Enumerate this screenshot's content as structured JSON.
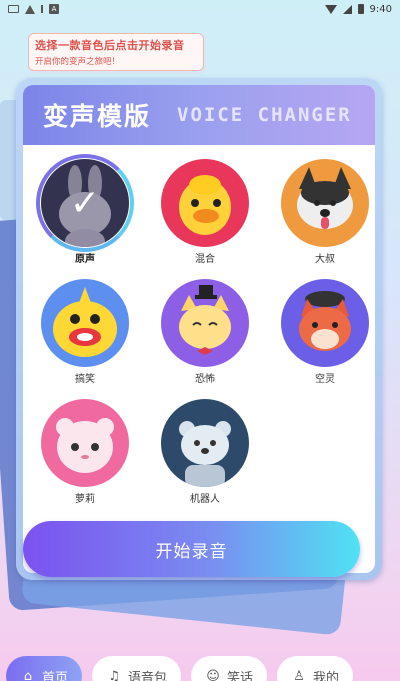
{
  "status_bar": {
    "time": "9:40"
  },
  "hint": {
    "main": "选择一款音色后点击开始录音",
    "sub": "开启你的变声之旅吧！"
  },
  "header": {
    "title_cn": "变声模版",
    "title_en": "VOICE  CHANGER"
  },
  "voices": [
    {
      "label": "原声",
      "selected": true
    },
    {
      "label": "混合",
      "selected": false
    },
    {
      "label": "大叔",
      "selected": false
    },
    {
      "label": "搞笑",
      "selected": false
    },
    {
      "label": "恐怖",
      "selected": false
    },
    {
      "label": "空灵",
      "selected": false
    },
    {
      "label": "萝莉",
      "selected": false
    },
    {
      "label": "机器人",
      "selected": false
    }
  ],
  "start_button": "开始录音",
  "bottom_nav": [
    {
      "label": "首页",
      "icon": "home-icon",
      "active": true
    },
    {
      "label": "语音包",
      "icon": "voice-pack-icon",
      "active": false
    },
    {
      "label": "笑话",
      "icon": "smile-icon",
      "active": false
    },
    {
      "label": "我的",
      "icon": "person-icon",
      "active": false
    }
  ],
  "colors": {
    "accent": "#7b6df0",
    "hint_red": "#e0504b"
  }
}
